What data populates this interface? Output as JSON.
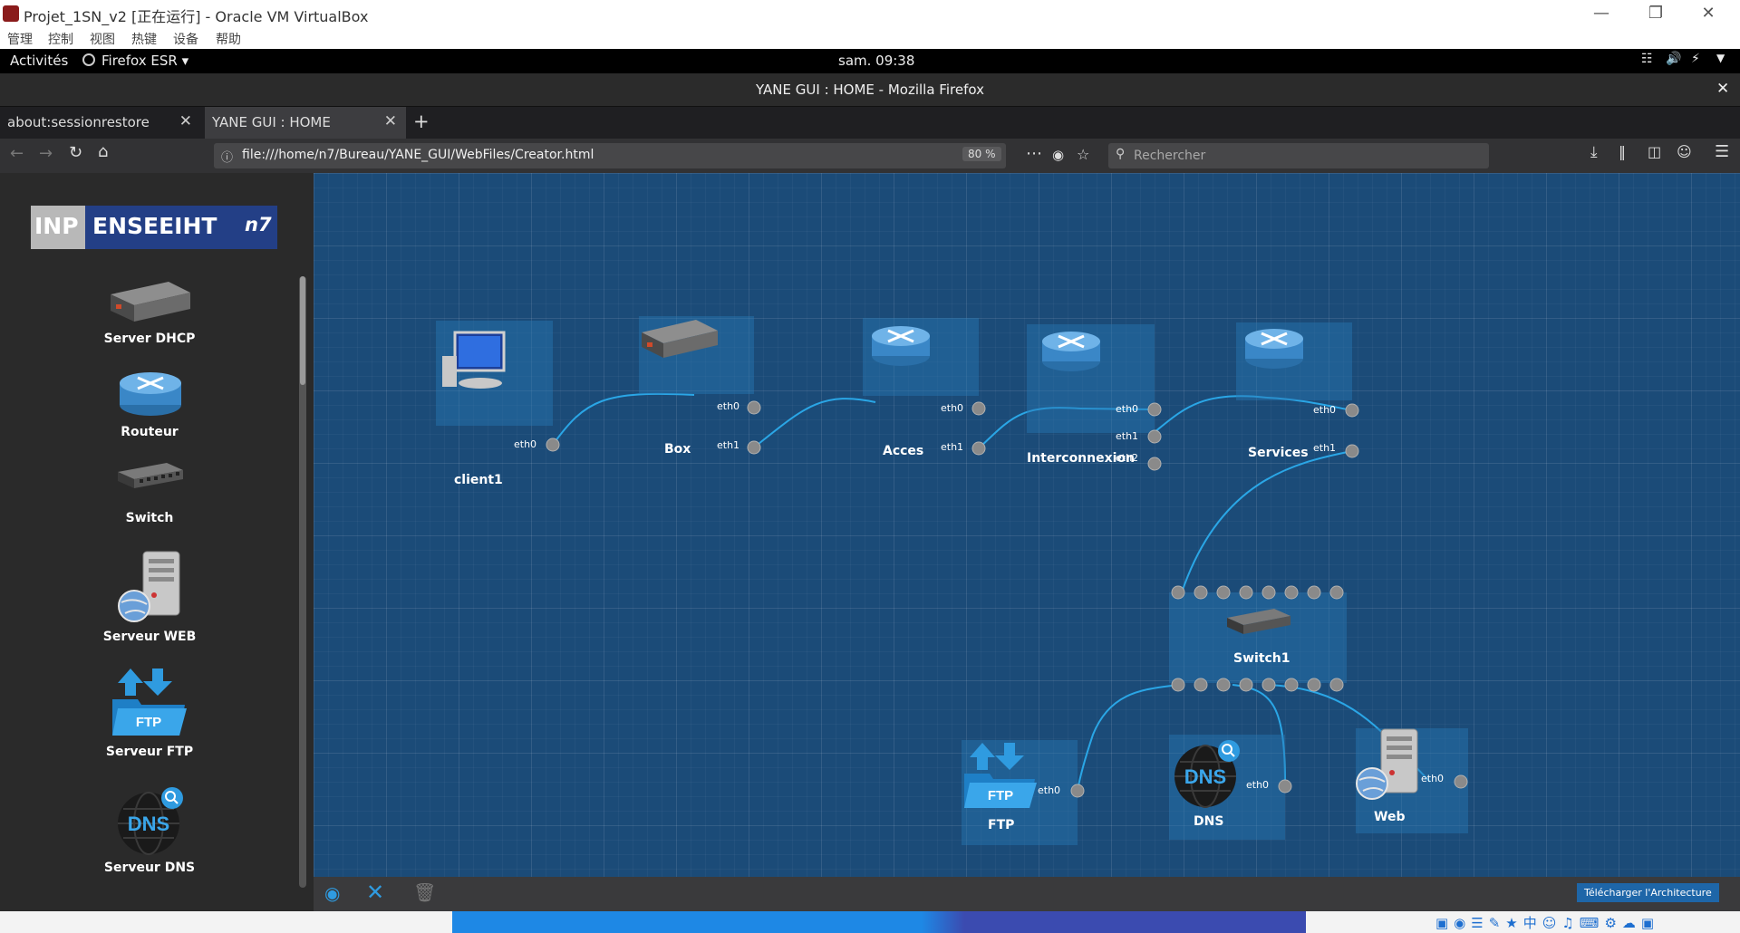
{
  "vbox": {
    "title": "Projet_1SN_v2 [正在运行] - Oracle VM VirtualBox",
    "menu": [
      "管理",
      "控制",
      "视图",
      "热键",
      "设备",
      "帮助"
    ]
  },
  "gnome": {
    "activities": "Activités",
    "app_menu": "Firefox ESR ▾",
    "clock": "sam. 09:38"
  },
  "firefox": {
    "window_title": "YANE GUI : HOME - Mozilla Firefox",
    "tabs": [
      {
        "label": "about:sessionrestore"
      },
      {
        "label": "YANE GUI : HOME"
      }
    ],
    "url": "file:///home/n7/Bureau/YANE_GUI/WebFiles/Creator.html",
    "zoom": "80 %",
    "search_placeholder": "Rechercher"
  },
  "sidebar": {
    "logo_inp": "INP",
    "logo_enseeiht": "ENSEEIHT",
    "items": [
      {
        "label": "Server DHCP",
        "icon": "dhcp-server-icon"
      },
      {
        "label": "Routeur",
        "icon": "router-icon"
      },
      {
        "label": "Switch",
        "icon": "switch-icon"
      },
      {
        "label": "Serveur WEB",
        "icon": "web-server-icon"
      },
      {
        "label": "Serveur FTP",
        "icon": "ftp-icon"
      },
      {
        "label": "Serveur DNS",
        "icon": "dns-icon"
      }
    ]
  },
  "icon_text": {
    "ftp": "FTP",
    "dns": "DNS"
  },
  "topology": {
    "nodes": [
      {
        "name": "client1",
        "ports": [
          "eth0"
        ]
      },
      {
        "name": "Box",
        "ports": [
          "eth0",
          "eth1"
        ]
      },
      {
        "name": "Acces",
        "ports": [
          "eth0",
          "eth1"
        ]
      },
      {
        "name": "Interconnexion",
        "ports": [
          "eth0",
          "eth1",
          "eth2"
        ]
      },
      {
        "name": "Services",
        "ports": [
          "eth0",
          "eth1"
        ]
      },
      {
        "name": "Switch1",
        "ports": []
      },
      {
        "name": "FTP",
        "ports": [
          "eth0"
        ]
      },
      {
        "name": "DNS",
        "ports": [
          "eth0"
        ]
      },
      {
        "name": "Web",
        "ports": [
          "eth0"
        ]
      }
    ]
  },
  "bottom": {
    "download_label": "Télécharger l'Architecture"
  },
  "colors": {
    "canvas_bg": "#1b4b78",
    "link": "#2aa6e6",
    "node_box": "#2878b4",
    "port": "#8a8a8a",
    "accent": "#2f9be0"
  }
}
